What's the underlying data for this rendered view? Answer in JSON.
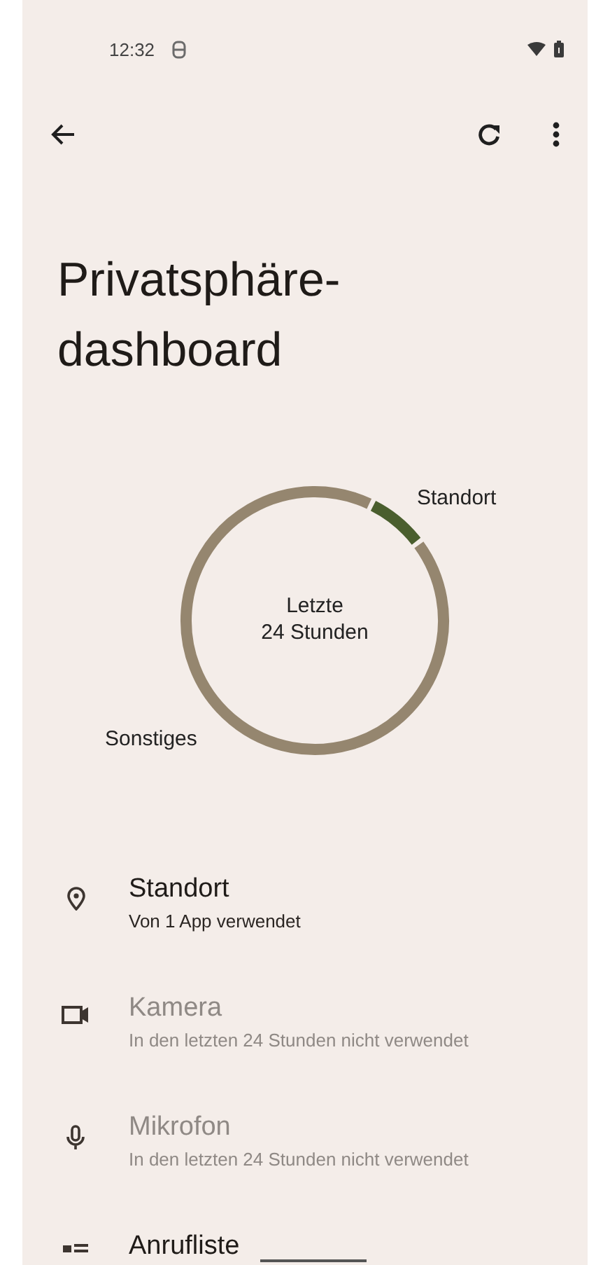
{
  "status_bar": {
    "time": "12:32"
  },
  "title": "Privatsphäre-\ndashboard",
  "donut": {
    "center_label": "Letzte\n24 Stunden",
    "labels": [
      {
        "text": "Standort",
        "color": "#4a5e2e"
      },
      {
        "text": "Sonstiges",
        "color": "#95866f"
      }
    ]
  },
  "permissions": [
    {
      "name": "Standort",
      "summary": "Von 1 App verwendet",
      "disabled": false
    },
    {
      "name": "Kamera",
      "summary": "In den letzten 24 Stunden nicht verwendet",
      "disabled": true
    },
    {
      "name": "Mikrofon",
      "summary": "In den letzten 24 Stunden nicht verwendet",
      "disabled": true
    },
    {
      "name": "Anrufliste",
      "disabled": false
    }
  ]
}
